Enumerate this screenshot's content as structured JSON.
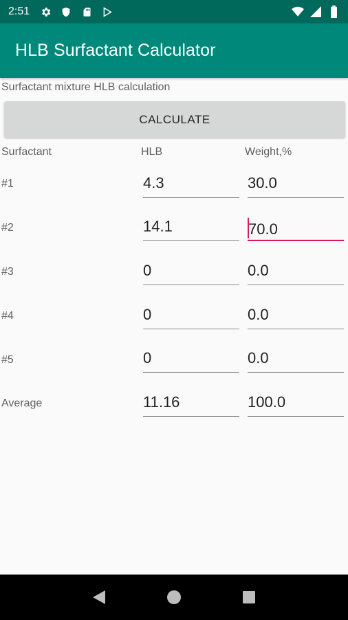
{
  "status_bar": {
    "time": "2:51"
  },
  "app_bar": {
    "title": "HLB Surfactant Calculator"
  },
  "subtitle": "Surfactant mixture HLB calculation",
  "calculate_button": "CALCULATE",
  "columns": {
    "surfactant": "Surfactant",
    "hlb": "HLB",
    "weight": "Weight,%"
  },
  "rows": [
    {
      "label": "#1",
      "hlb": "4.3",
      "weight": "30.0"
    },
    {
      "label": "#2",
      "hlb": "14.1",
      "weight": "70.0",
      "weight_focused": true
    },
    {
      "label": "#3",
      "hlb": "0",
      "weight": "0.0"
    },
    {
      "label": "#4",
      "hlb": "0",
      "weight": "0.0"
    },
    {
      "label": "#5",
      "hlb": "0",
      "weight": "0.0"
    }
  ],
  "average": {
    "label": "Average",
    "hlb": "11.16",
    "weight": "100.0"
  },
  "colors": {
    "status_bar": "#00695c",
    "app_bar": "#00897b",
    "focus_accent": "#d81b60"
  }
}
